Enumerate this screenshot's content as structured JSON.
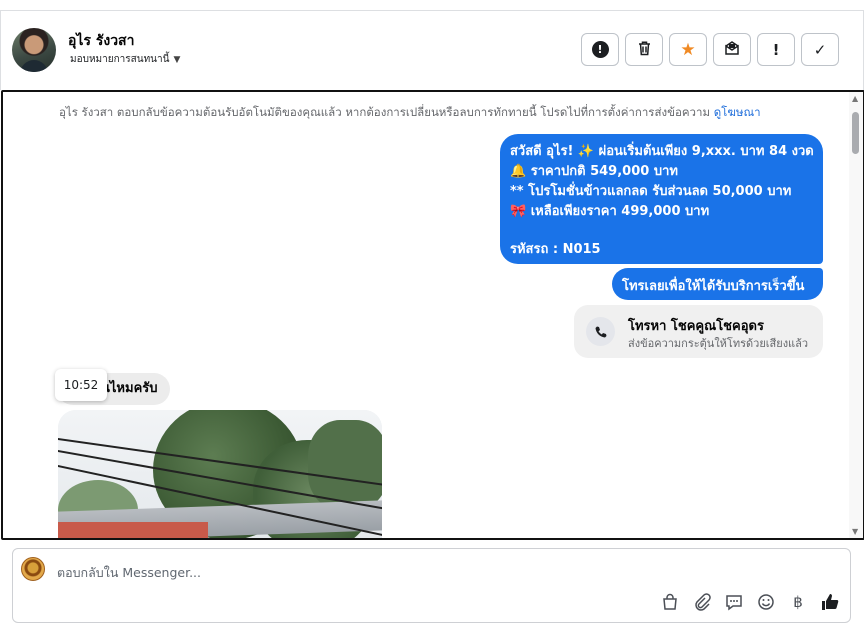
{
  "header": {
    "contact_name": "อุไร รังวสา",
    "assign_label": "มอบหมายการสนทนานี้",
    "toolbar": {
      "spam": "!",
      "trash": "🗑",
      "star": "★",
      "mail": "✉",
      "follow_up": "!",
      "done": "✓"
    }
  },
  "thread": {
    "notice_text": "อุไร รังวสา ตอบกลับข้อความต้อนรับอัตโนมัติของคุณแล้ว หากต้องการเปลี่ยนหรือลบการทักทายนี้ โปรดไปที่การตั้งค่าการส่งข้อความ",
    "notice_link": "ดูโฆษณา",
    "outgoing_lines": [
      "สวัสดี อุไร! ✨ ผ่อนเริ่มต้นเพียง 9,xxx. บาท 84 งวด",
      "🔔 ราคาปกติ 549,000 บาท",
      "** โปรโมชั่นข้าวแลกลด รับส่วนลด 50,000 บาท",
      "🎀 เหลือเพียงราคา 499,000 บาท",
      "",
      "รหัสรถ : N015"
    ],
    "cta_bubble": "โทรเลยเพื่อให้ได้รับบริการเร็วขึ้น",
    "call_card": {
      "title": "โทรหา โชคคูณโชคอุดร",
      "subtitle": "ส่งข้อความกระตุ้นให้โทรด้วยเสียงแล้ว"
    },
    "incoming_text": "นไหมครับ",
    "tooltip_time": "10:52"
  },
  "composer": {
    "placeholder": "ตอบกลับใน Messenger...",
    "icons": [
      "shopping-bag-icon",
      "paperclip-icon",
      "saved-reply-icon",
      "emoji-icon",
      "baht-icon",
      "thumbs-up-icon"
    ]
  }
}
